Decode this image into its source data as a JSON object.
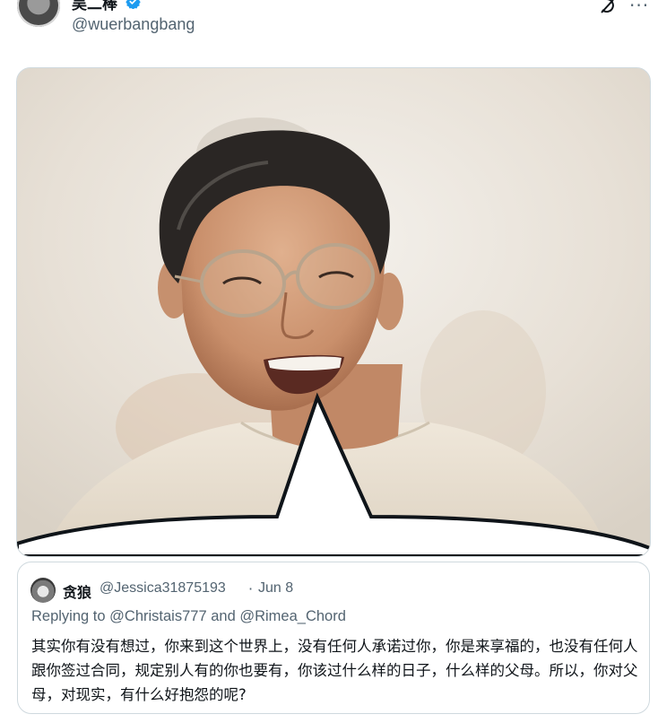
{
  "author": {
    "display_name": "吴二棒",
    "handle": "@wuerbangbang",
    "avatar_icon": "avatar-image",
    "verified_icon": "verified-badge-icon",
    "verified_color": "#1d9bf0"
  },
  "actions": {
    "grok_icon": "grok-icon",
    "more_label": "···"
  },
  "media": {
    "image_icon": "photo-smiling-man-speech-bubble"
  },
  "quote": {
    "name": "贪狼",
    "handle": "@Jessica31875193",
    "separator": "·",
    "date": "Jun 8",
    "reply_prefix": "Replying to",
    "mention_1": "@Christais777",
    "conj": "and",
    "mention_2": "@Rimea_Chord",
    "text": "其实你有没有想过，你来到这个世界上，没有任何人承诺过你，你是来享福的，也没有任何人跟你签过合同，规定别人有的你也要有，你该过什么样的日子，什么样的父母。所以，你对父母，对现实，有什么好抱怨的呢?"
  },
  "colors": {
    "text_primary": "#0f1419",
    "text_secondary": "#536471",
    "border": "#cfd9de"
  }
}
